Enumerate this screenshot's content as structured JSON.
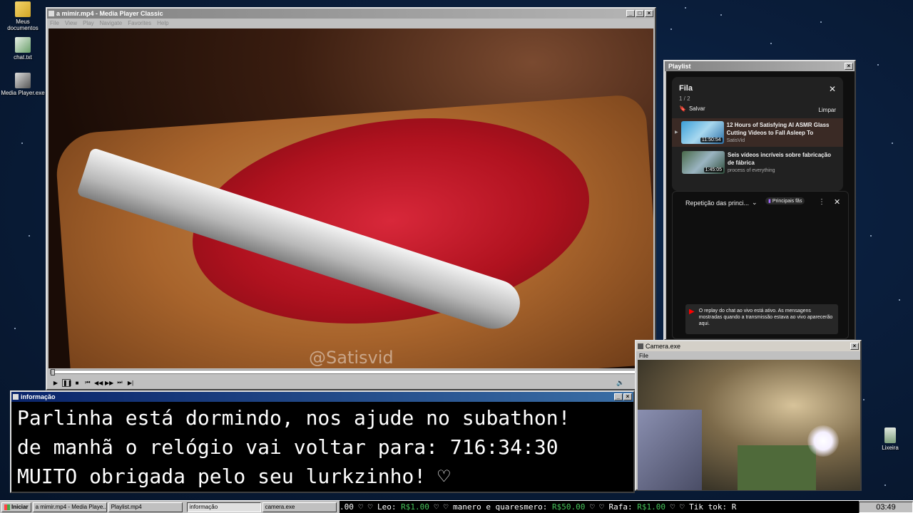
{
  "desktop": {
    "icons": [
      {
        "label": "Meus documentos",
        "icon": "folder-icon"
      },
      {
        "label": "chat.txt",
        "icon": "text-file-icon"
      },
      {
        "label": "Media Player.exe",
        "icon": "media-player-icon"
      },
      {
        "label": "Lixeira",
        "icon": "recycle-bin-icon"
      }
    ]
  },
  "media_player": {
    "title": "a mimir.mp4 - Media Player Classic",
    "menu": [
      "File",
      "View",
      "Play",
      "Navigate",
      "Favorites",
      "Help"
    ],
    "watermark": "@Satisvid",
    "progress": 0.0
  },
  "playlist_window": {
    "title": "Playlist",
    "queue": {
      "heading": "Fila",
      "position": "1 / 2",
      "save_label": "Salvar",
      "clear_label": "Limpar",
      "items": [
        {
          "title": "12 Hours of Satisfying AI ASMR Glass Cutting Videos to Fall Asleep To",
          "channel": "SatisVid",
          "duration": "11:50:54",
          "playing": true
        },
        {
          "title": "Seis vídeos incríveis sobre fabricação de fábrica",
          "channel": "process of everything",
          "duration": "1:45:05",
          "playing": false
        }
      ]
    },
    "chat": {
      "mode_label": "Repetição das princi...",
      "badge": "Principais fãs",
      "replay_notice": "O replay do chat ao vivo está ativo. As mensagens mostradas quando a transmissão estava ao vivo aparecerão aqui."
    }
  },
  "info_window": {
    "title": "informação",
    "lines": [
      "Parlinha está dormindo, nos ajude no subathon!",
      "de manhã o relógio vai voltar para:  716:34:30",
      "MUITO obrigada pelo seu lurkzinho! ♡"
    ]
  },
  "camera_window": {
    "title": "Camera.exe",
    "menu": "File"
  },
  "taskbar": {
    "start_label": "Iniciar",
    "items": [
      "a mimir.mp4 - Media Playe...",
      "Playlist.mp4",
      "informação",
      "camera.exe"
    ],
    "active_index": 2,
    "ticker": [
      {
        "text": ".00 ♡  ♡ Leo: ",
        "money": ""
      },
      {
        "text": "",
        "money": "R$1.00"
      },
      {
        "text": " ♡  ♡ manero e quaresmero: ",
        "money": ""
      },
      {
        "text": "",
        "money": "R$50.00"
      },
      {
        "text": " ♡  ♡ Rafa: ",
        "money": ""
      },
      {
        "text": "",
        "money": "R$1.00"
      },
      {
        "text": " ♡  ♡ Tik tok: R",
        "money": ""
      }
    ],
    "clock": "03:49"
  },
  "colors": {
    "accent": "#0a246a",
    "money": "#46c35a",
    "yt_bg": "#0f0f0f"
  }
}
